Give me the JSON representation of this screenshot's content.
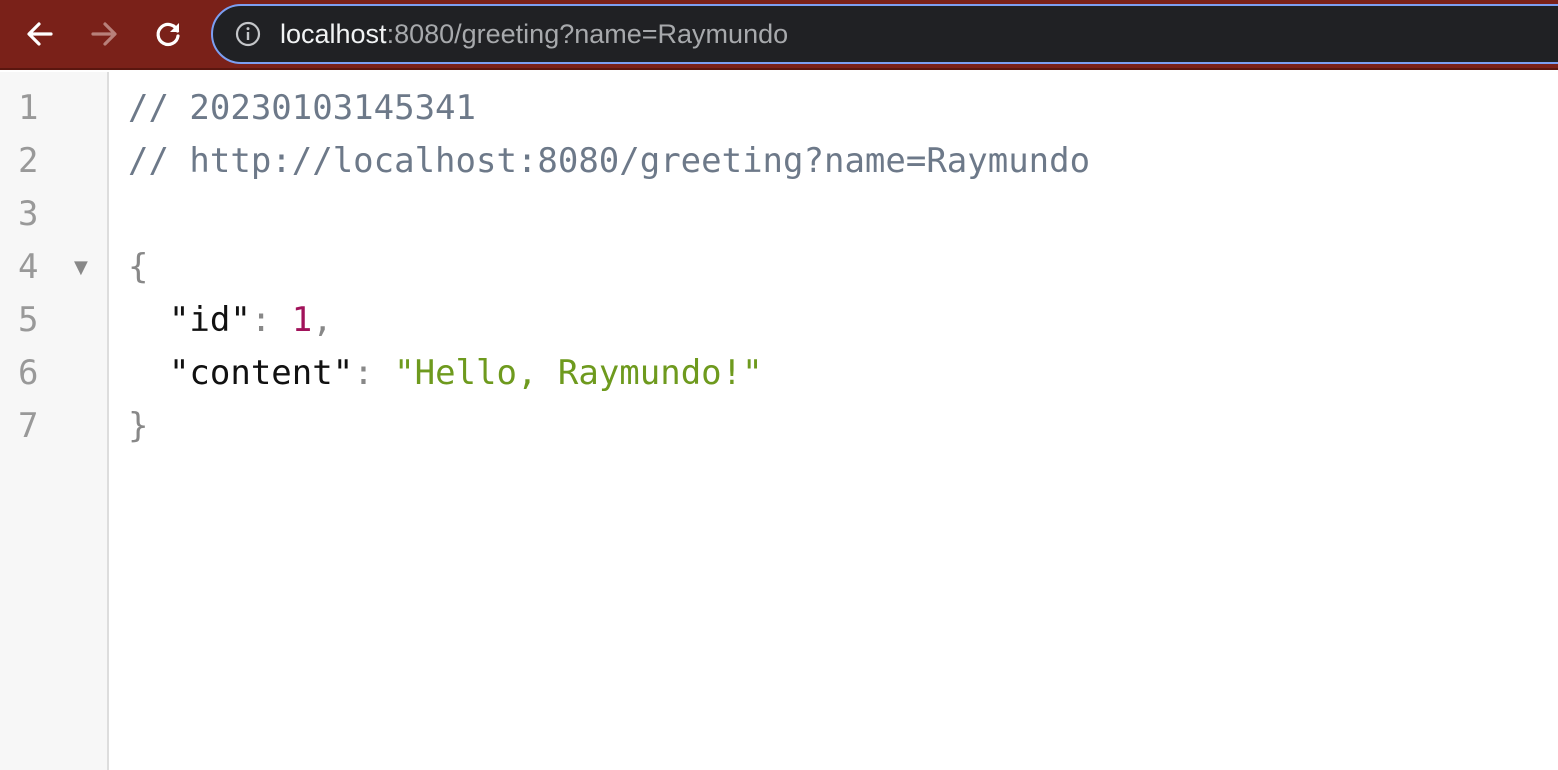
{
  "browser": {
    "url_host": "localhost",
    "url_rest": ":8080/greeting?name=Raymundo",
    "colors": {
      "toolbar_bg": "#7a2119",
      "omnibox_bg": "#202124",
      "omnibox_border": "#7c9ff2"
    },
    "icons": {
      "back": "arrow-left-icon",
      "forward": "arrow-right-icon",
      "reload": "reload-icon",
      "site_info": "info-icon"
    }
  },
  "viewer": {
    "line_numbers": [
      "1",
      "2",
      "3",
      "4",
      "5",
      "6",
      "7"
    ],
    "fold_marker": "▼",
    "comment_timestamp": "// 20230103145341",
    "comment_url": "// http://localhost:8080/greeting?name=Raymundo",
    "open_brace": "{",
    "close_brace": "}",
    "colon": ": ",
    "comma": ",",
    "entries": [
      {
        "key": "\"id\"",
        "value": "1"
      },
      {
        "key": "\"content\"",
        "value": "\"Hello, Raymundo!\""
      }
    ],
    "colors": {
      "comment": "#6d7989",
      "number": "#a1125a",
      "string": "#6e9a1e"
    }
  }
}
